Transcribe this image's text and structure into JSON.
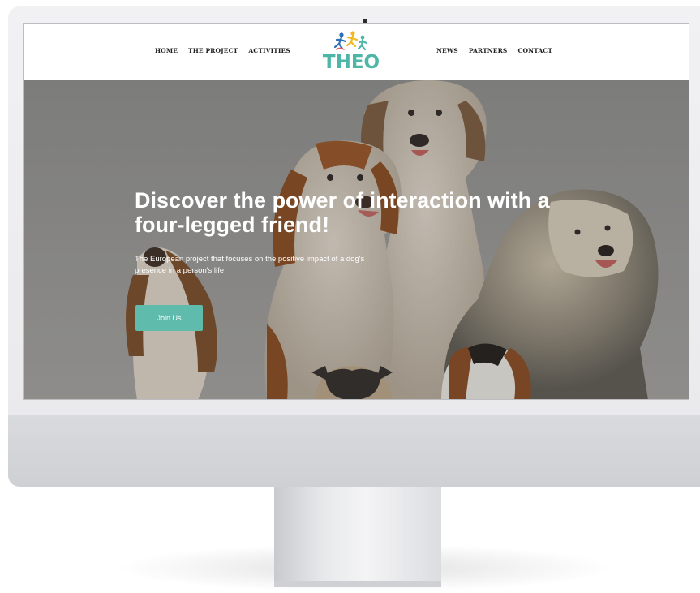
{
  "nav": {
    "left": [
      "HOME",
      "THE PROJECT",
      "ACTIVITIES"
    ],
    "right": [
      "NEWS",
      "PARTNERS",
      "CONTACT"
    ]
  },
  "logo": {
    "text": "THEO",
    "icon": "running-figures-icon"
  },
  "hero": {
    "title": "Discover the power of interaction with a four-legged friend!",
    "subtitle": "The European project that focuses on the positive impact of a dog's presence in a person's life.",
    "cta_label": "Join Us"
  },
  "colors": {
    "accent": "#5fbcac",
    "logo": "#4db6a6",
    "nav_text": "#222222"
  }
}
